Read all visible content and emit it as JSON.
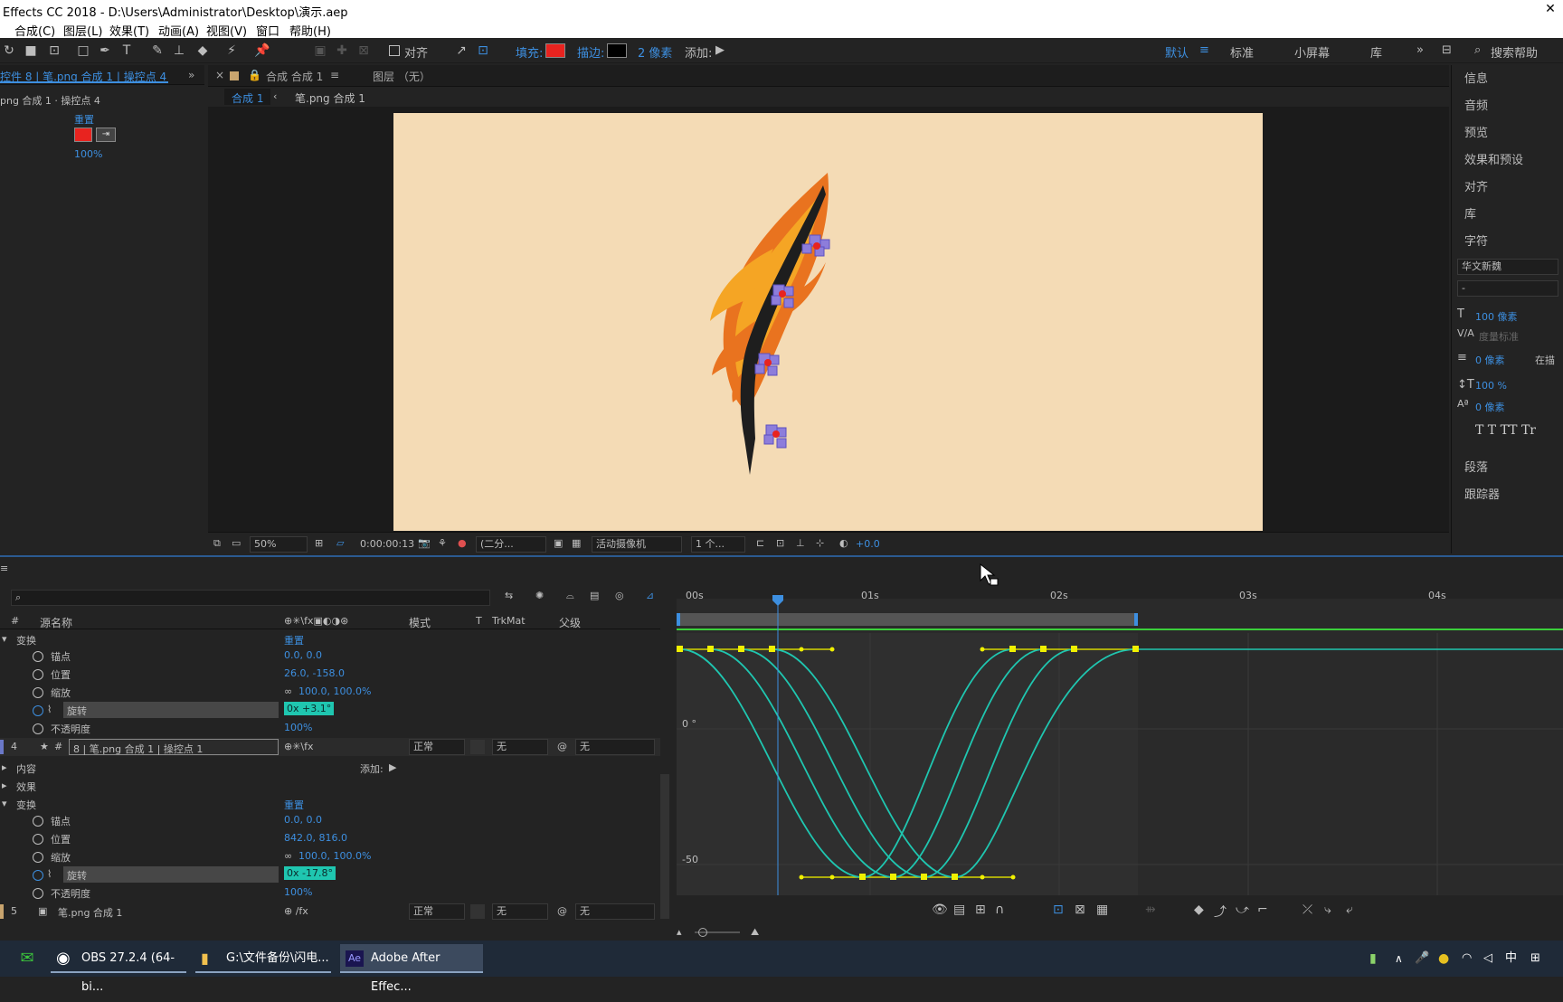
{
  "window": {
    "title": "Effects CC 2018 - D:\\Users\\Administrator\\Desktop\\演示.aep",
    "close": "✕"
  },
  "menu": [
    "合成(C)",
    "图层(L)",
    "效果(T)",
    "动画(A)",
    "视图(V)",
    "窗口",
    "帮助(H)"
  ],
  "toolbar": {
    "align_label": "对齐",
    "fill_label": "填充:",
    "fill_color": "#e8231f",
    "stroke_label": "描边:",
    "stroke_color": "#000000",
    "stroke_width": "2 像素",
    "add_label": "添加:",
    "workspaces": [
      "默认",
      "标准",
      "小屏幕",
      "库"
    ],
    "search_help": "搜索帮助"
  },
  "left_panel": {
    "tab": "控件 8 | 笔.png 合成 1 | 操控点 4",
    "crumb": "png 合成 1 · 操控点 4",
    "reset": "重置",
    "fill_color": "#e8231f",
    "opacity": "100%"
  },
  "comp_panel": {
    "tab": "合成 合成 1",
    "layer_tab": "图层 （无）",
    "crumb_active": "合成 1",
    "crumb_other": "笔.png 合成 1"
  },
  "viewer_bar": {
    "zoom": "50%",
    "timecode": "0:00:00:13",
    "resolution": "(二分...",
    "camera": "活动摄像机",
    "views": "1 个...",
    "exposure": "+0.0"
  },
  "right_panel": {
    "items": [
      "信息",
      "音频",
      "预览",
      "效果和预设",
      "对齐",
      "库",
      "字符"
    ],
    "font": "华文新魏",
    "font_style": "-",
    "font_size": "100 像素",
    "kerning": "度量标准",
    "stroke_px": "0 像素",
    "stroke_opt": "在描",
    "vscale": "100 %",
    "baseline": "0 像素",
    "bottom_items": [
      "段落",
      "跟踪器"
    ]
  },
  "timeline": {
    "columns": {
      "num": "#",
      "source": "源名称",
      "mode": "模式",
      "t": "T",
      "trkmat": "TrkMat",
      "parent": "父级"
    },
    "group1": {
      "transform": "变换",
      "reset": "重置",
      "props": [
        {
          "name": "锚点",
          "value": "0.0, 0.0"
        },
        {
          "name": "位置",
          "value": "26.0, -158.0"
        },
        {
          "name": "缩放",
          "value": "100.0, 100.0%"
        },
        {
          "name": "旋转",
          "value": "0x +3.1°"
        },
        {
          "name": "不透明度",
          "value": "100%"
        }
      ]
    },
    "layer4": {
      "num": "4",
      "name": "8 | 笔.png 合成 1 | 操控点 1",
      "mode": "正常",
      "trkmat": "无",
      "parent": "无",
      "contents": "内容",
      "add": "添加:",
      "effects": "效果"
    },
    "group2": {
      "transform": "变换",
      "reset": "重置",
      "props": [
        {
          "name": "锚点",
          "value": "0.0, 0.0"
        },
        {
          "name": "位置",
          "value": "842.0, 816.0"
        },
        {
          "name": "缩放",
          "value": "100.0, 100.0%"
        },
        {
          "name": "旋转",
          "value": "0x -17.8°"
        },
        {
          "name": "不透明度",
          "value": "100%"
        }
      ]
    },
    "layer5": {
      "num": "5",
      "name": "笔.png 合成 1",
      "mode": "正常",
      "trkmat": "无",
      "parent": "无"
    },
    "ruler": [
      "00s",
      "01s",
      "02s",
      "03s",
      "04s"
    ],
    "graph_labels": {
      "zero": "0 °",
      "minus50": "-50"
    }
  },
  "taskbar": {
    "apps": [
      "OBS 27.2.4 (64-bi...",
      "G:\\文件备份\\闪电...",
      "Adobe After Effec..."
    ],
    "ime": "中"
  }
}
